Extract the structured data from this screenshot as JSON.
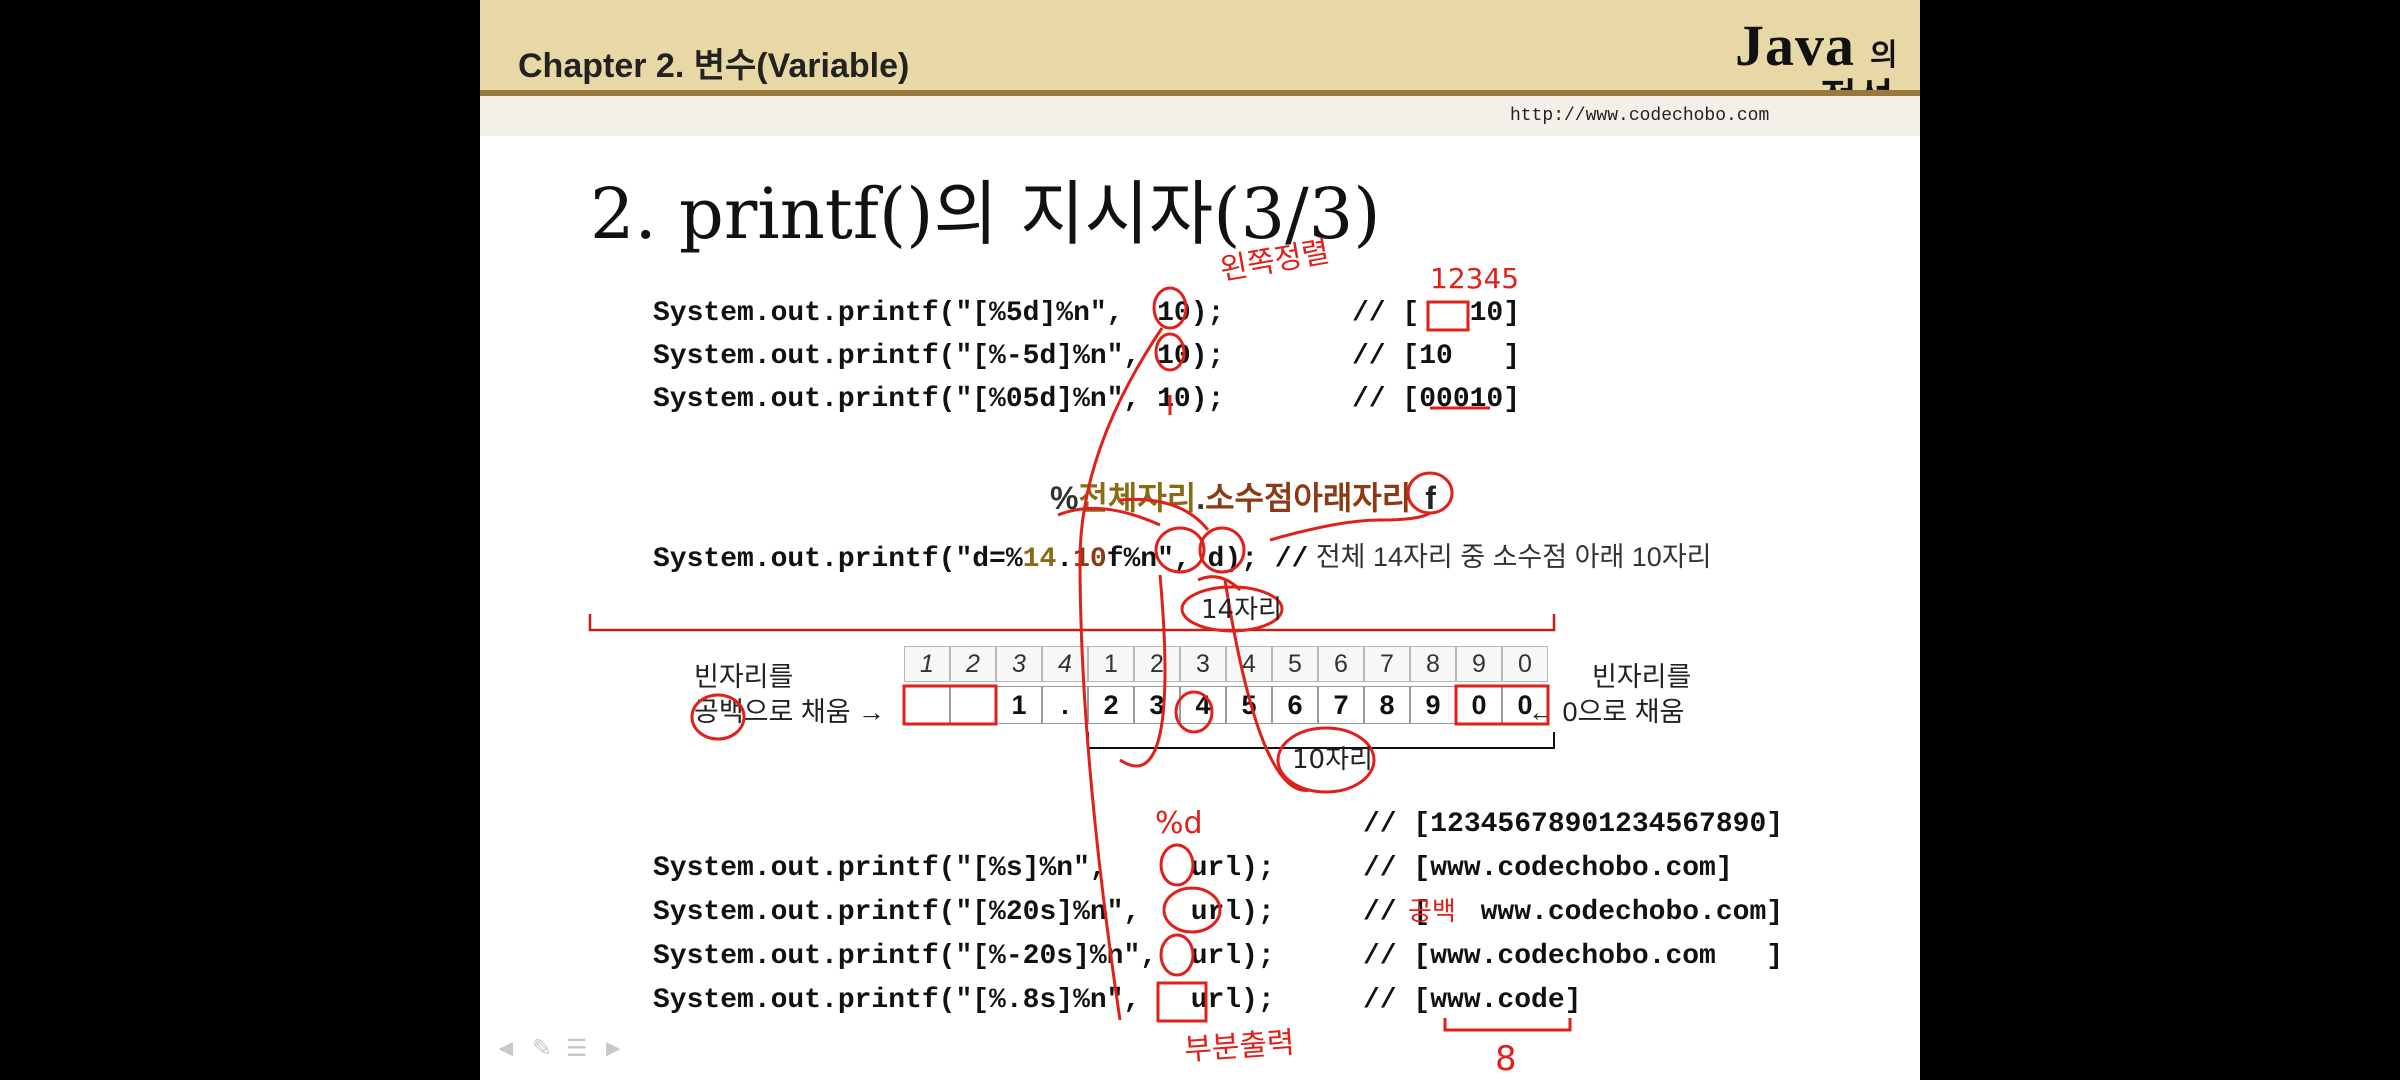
{
  "header": {
    "chapter": "Chapter 2. 변수(Variable)",
    "logo_java": "Java",
    "logo_ui": "의",
    "logo_jeongseok": "정석",
    "url": "http://www.codechobo.com"
  },
  "title": "2. printf()의 지시자(3/3)",
  "int_examples": [
    {
      "code": "System.out.printf(\"[%5d]%n\",  10);",
      "result": "// [   10]"
    },
    {
      "code": "System.out.printf(\"[%-5d]%n\", 10);",
      "result": "// [10   ]"
    },
    {
      "code": "System.out.printf(\"[%05d]%n\", 10);",
      "result": "// [00010]"
    }
  ],
  "format_explain": {
    "percent": "%",
    "total": "전체자리",
    "dot": ".",
    "frac": "소수점아래자리",
    "f": "f"
  },
  "double_example": {
    "pre": "System.out.printf(\"d=%",
    "total": "14",
    "dot": ".",
    "frac": "10",
    "post": "f%n\", d); //",
    "comment": " 전체 14자리 중 소수점 아래 10자리"
  },
  "digit_table": {
    "index": [
      "1",
      "2",
      "3",
      "4",
      "1",
      "2",
      "3",
      "4",
      "5",
      "6",
      "7",
      "8",
      "9",
      "0"
    ],
    "values": [
      "",
      "",
      "1",
      ".",
      "2",
      "3",
      "4",
      "5",
      "6",
      "7",
      "8",
      "9",
      "0",
      "0"
    ],
    "left_note_1": "빈자리를",
    "left_note_2": "공백으로 채움 →",
    "right_note_1": "빈자리를",
    "right_note_2": "← 0으로 채움"
  },
  "string_examples": {
    "ruler": "// [12345678901234567890]",
    "rows": [
      {
        "code": "System.out.printf(\"[%s]%n\",     url);",
        "result": "// [www.codechobo.com]"
      },
      {
        "code": "System.out.printf(\"[%20s]%n\",   url);",
        "result": "// [   www.codechobo.com]"
      },
      {
        "code": "System.out.printf(\"[%-20s]%n\",  url);",
        "result": "// [www.codechobo.com   ]"
      },
      {
        "code": "System.out.printf(\"[%.8s]%n\",   url);",
        "result": "// [www.code]"
      }
    ]
  },
  "annotations": {
    "left_align": "왼쪽정렬",
    "nums": "12345",
    "fourteen": "14자리",
    "ten": "10자리",
    "percent_d": "%d",
    "blank": "공백",
    "partial": "부분출력",
    "eight": "8"
  },
  "colors": {
    "accent": "#e0201a",
    "header": "#e8d8a6",
    "header_line": "#9a7a3c"
  }
}
